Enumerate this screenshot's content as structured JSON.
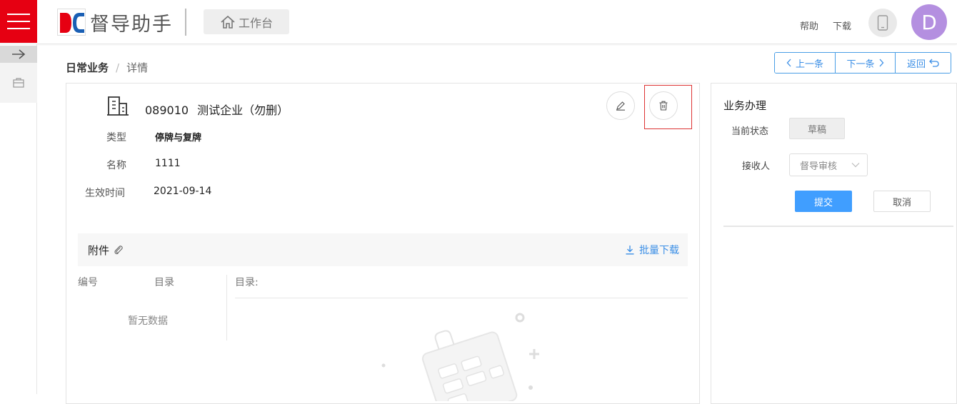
{
  "header": {
    "logo_text": "督导助手",
    "workbench_label": "工作台",
    "help_label": "帮助",
    "download_label": "下载",
    "avatar_letter": "D"
  },
  "breadcrumb": {
    "parent": "日常业务",
    "separator": "/",
    "current": "详情"
  },
  "pager": {
    "prev_label": "上一条",
    "next_label": "下一条",
    "back_label": "返回"
  },
  "record": {
    "company_code": "089010",
    "company_name": "测试企业（勿删）",
    "fields": [
      {
        "label": "类型",
        "value": "停牌与复牌"
      },
      {
        "label": "名称",
        "value": "1111"
      },
      {
        "label": "生效时间",
        "value": "2021-09-14"
      }
    ]
  },
  "attachments": {
    "title": "附件",
    "batch_download_label": "批量下载",
    "col_number": "编号",
    "col_directory": "目录",
    "directory_header": "目录:",
    "empty_text": "暂无数据"
  },
  "processing": {
    "title": "业务办理",
    "status_label": "当前状态",
    "status_value": "草稿",
    "receiver_label": "接收人",
    "receiver_value": "督导审核",
    "submit_label": "提交",
    "cancel_label": "取消"
  },
  "colors": {
    "brand_red": "#e60012",
    "accent_blue": "#409eff",
    "avatar_purple": "#b48fe0"
  }
}
